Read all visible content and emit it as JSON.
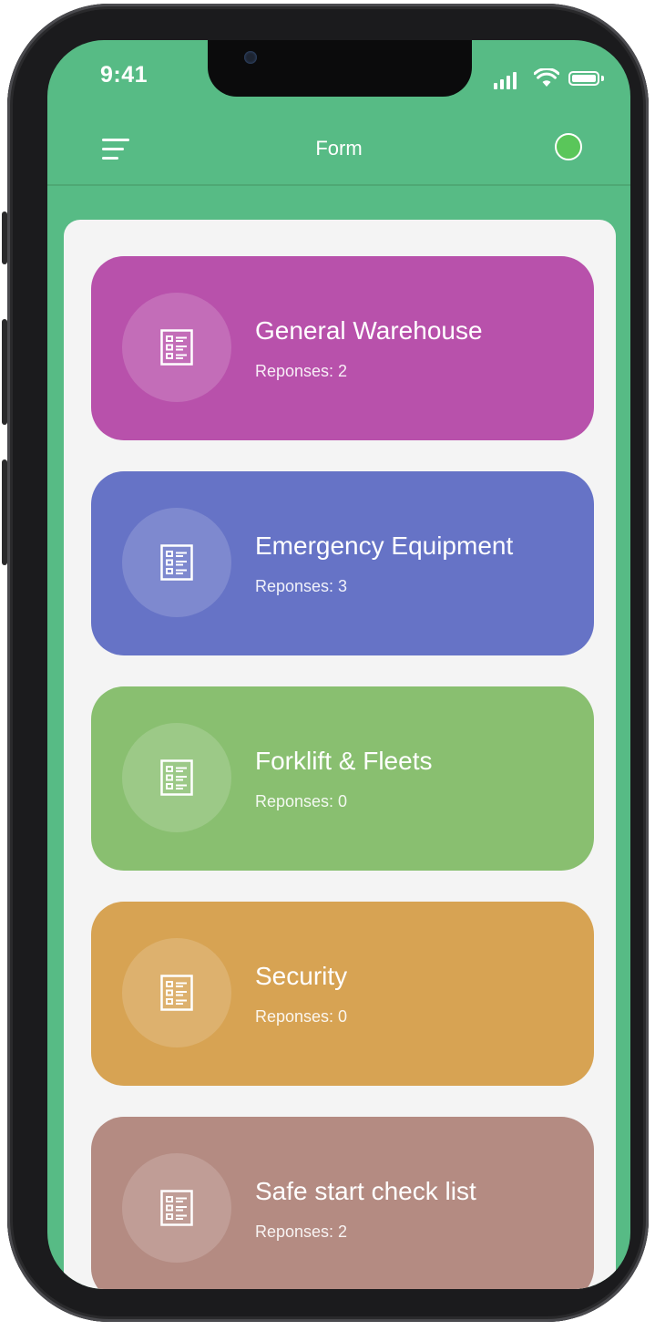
{
  "status_bar": {
    "time": "9:41"
  },
  "header": {
    "title": "Form"
  },
  "colors": {
    "app_green": "#57bb85",
    "status_dot": "#5ac65a",
    "panel": "#f4f4f4"
  },
  "forms": [
    {
      "title": "General Warehouse",
      "responses": "Reponses: 2",
      "color": "#b851ab",
      "icon": "form-list-icon"
    },
    {
      "title": "Emergency Equipment",
      "responses": "Reponses: 3",
      "color": "#6673c6",
      "icon": "form-list-icon"
    },
    {
      "title": "Forklift & Fleets",
      "responses": "Reponses: 0",
      "color": "#89bf70",
      "icon": "form-list-icon"
    },
    {
      "title": "Security",
      "responses": "Reponses: 0",
      "color": "#d7a353",
      "icon": "form-list-icon"
    },
    {
      "title": "Safe start check list",
      "responses": "Reponses: 2",
      "color": "#b48b82",
      "icon": "form-list-icon"
    }
  ]
}
